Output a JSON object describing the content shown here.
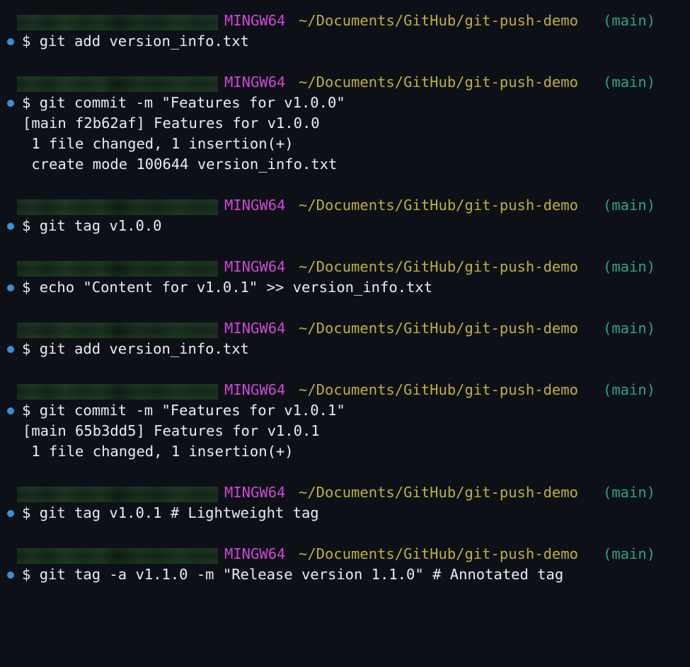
{
  "prompt": {
    "host": "MINGW64",
    "path": "~/Documents/GitHub/git-push-demo",
    "branch": "(main)",
    "symbol": "$"
  },
  "blocks": [
    {
      "command": "git add version_info.txt",
      "output": []
    },
    {
      "command": "git commit -m \"Features for v1.0.0\"",
      "output": [
        "[main f2b62af] Features for v1.0.0",
        " 1 file changed, 1 insertion(+)",
        " create mode 100644 version_info.txt"
      ]
    },
    {
      "command": "git tag v1.0.0",
      "output": []
    },
    {
      "command": "echo \"Content for v1.0.1\" >> version_info.txt",
      "output": []
    },
    {
      "command": "git add version_info.txt",
      "output": []
    },
    {
      "command": "git commit -m \"Features for v1.0.1\"",
      "output": [
        "[main 65b3dd5] Features for v1.0.1",
        " 1 file changed, 1 insertion(+)"
      ]
    },
    {
      "command": "git tag v1.0.1 # Lightweight tag",
      "output": []
    },
    {
      "command": "git tag -a v1.1.0 -m \"Release version 1.1.0\" # Annotated tag",
      "output": []
    }
  ],
  "colors": {
    "background": "#0d1117",
    "host": "#d147d6",
    "path": "#c0ae3e",
    "branch": "#2aa57e",
    "command_dot": "#3b8fd6",
    "text": "#e6edf3"
  }
}
